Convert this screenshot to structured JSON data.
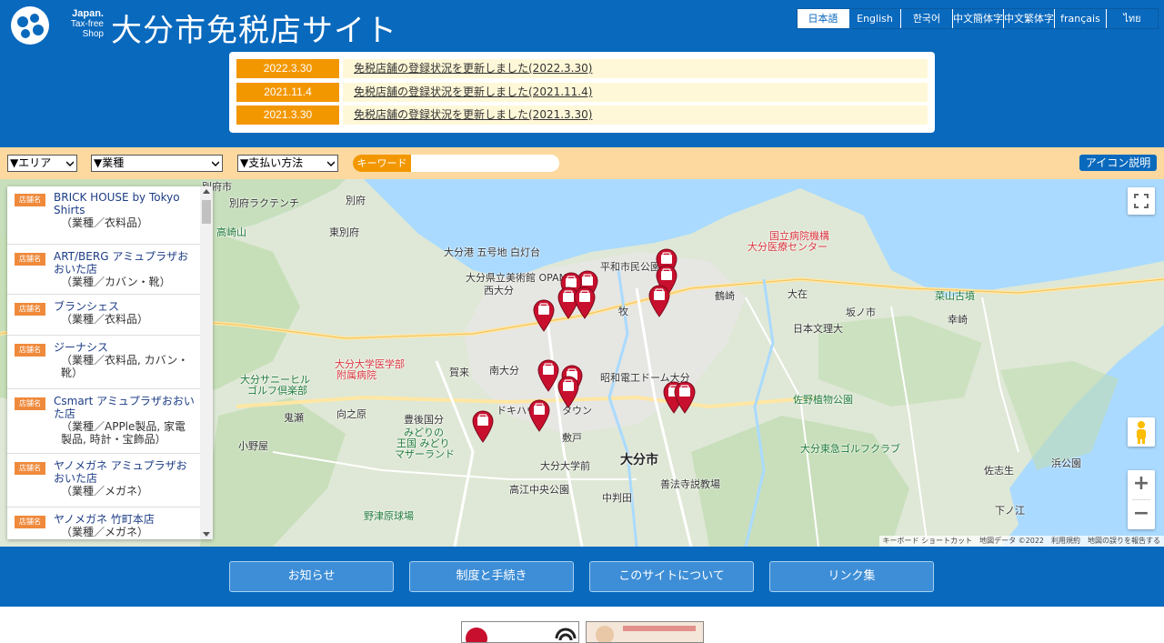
{
  "header": {
    "logo": {
      "line1": "Japan.",
      "line2": "Tax-free",
      "line3": "Shop"
    },
    "title": "大分市免税店サイト",
    "languages": [
      "日本語",
      "English",
      "한국어",
      "中文簡体字",
      "中文繁体字",
      "français",
      "ไทย"
    ]
  },
  "news": [
    {
      "date": "2022.3.30",
      "text": "免税店舗の登録状況を更新しました(2022.3.30)"
    },
    {
      "date": "2021.11.4",
      "text": "免税店舗の登録状況を更新しました(2021.11.4)"
    },
    {
      "date": "2021.3.30",
      "text": "免税店舗の登録状況を更新しました(2021.3.30)"
    }
  ],
  "filters": {
    "area": "▼エリア",
    "industry": "▼業種",
    "payment": "▼支払い方法",
    "keyword_label": "キーワード",
    "keyword_value": "",
    "icon_legend": "アイコン説明"
  },
  "shop_list": {
    "tag": "店舗名",
    "items": [
      {
        "name": "BRICK HOUSE by Tokyo Shirts",
        "category": "（業種／衣料品）"
      },
      {
        "name": "ART/BERG アミュプラザおおいた店",
        "category": "（業種／カバン・靴）"
      },
      {
        "name": "ブランシェス",
        "category": "（業種／衣料品）"
      },
      {
        "name": "ジーナシス",
        "category": "（業種／衣料品, カバン・靴）"
      },
      {
        "name": "Csmart アミュプラザおおいた店",
        "category": "（業種／APPle製品, 家電製品, 時計・宝飾品）"
      },
      {
        "name": "ヤノメガネ アミュプラザおおいた店",
        "category": "（業種／メガネ）"
      },
      {
        "name": "ヤノメガネ 竹町本店",
        "category": "（業種／メガネ）"
      }
    ]
  },
  "map": {
    "labels": [
      {
        "text": "別府市"
      },
      {
        "text": "別府ラクテンチ"
      },
      {
        "text": "別府"
      },
      {
        "text": "東別府"
      },
      {
        "text": "高崎山"
      },
      {
        "text": "大分港 五号地 白灯台"
      },
      {
        "text": "大分県立美術館 OPAM"
      },
      {
        "text": "西大分"
      },
      {
        "text": "平和市民公園"
      },
      {
        "text": "国立病院機構"
      },
      {
        "text": "大分医療センター"
      },
      {
        "text": "鶴崎"
      },
      {
        "text": "大在"
      },
      {
        "text": "坂ノ市"
      },
      {
        "text": "日本文理大"
      },
      {
        "text": "幸崎"
      },
      {
        "text": "菜山古墳"
      },
      {
        "text": "大分大学医学部"
      },
      {
        "text": "附属病院"
      },
      {
        "text": "大分サニーヒル"
      },
      {
        "text": "ゴルフ倶楽部"
      },
      {
        "text": "賀来"
      },
      {
        "text": "南大分"
      },
      {
        "text": "昭和電工ドーム大分"
      },
      {
        "text": "佐野植物公園"
      },
      {
        "text": "鬼瀬"
      },
      {
        "text": "向之原"
      },
      {
        "text": "豊後国分"
      },
      {
        "text": "みどりの"
      },
      {
        "text": "王国 みどり"
      },
      {
        "text": "マザーランド"
      },
      {
        "text": "ドキハウ"
      },
      {
        "text": "タウン"
      },
      {
        "text": "敷戸"
      },
      {
        "text": "大分市"
      },
      {
        "text": "大分東急ゴルフクラブ"
      },
      {
        "text": "大分大学前"
      },
      {
        "text": "高江中央公園"
      },
      {
        "text": "中判田"
      },
      {
        "text": "善法寺説教場"
      },
      {
        "text": "佐志生"
      },
      {
        "text": "浜公園"
      },
      {
        "text": "野津原球場"
      },
      {
        "text": "下ノ江"
      },
      {
        "text": "小野屋"
      },
      {
        "text": "牧"
      }
    ],
    "attribution": [
      "キーボード ショートカット",
      "地図データ ©2022",
      "利用規約",
      "地図の誤りを報告する"
    ]
  },
  "footer_nav": [
    "お知らせ",
    "制度と手続き",
    "このサイトについて",
    "リンク集"
  ],
  "colors": {
    "primary": "#0969bd",
    "accent": "#f39700",
    "filter_bg": "#fdd9a0",
    "pin": "#c8102e"
  }
}
